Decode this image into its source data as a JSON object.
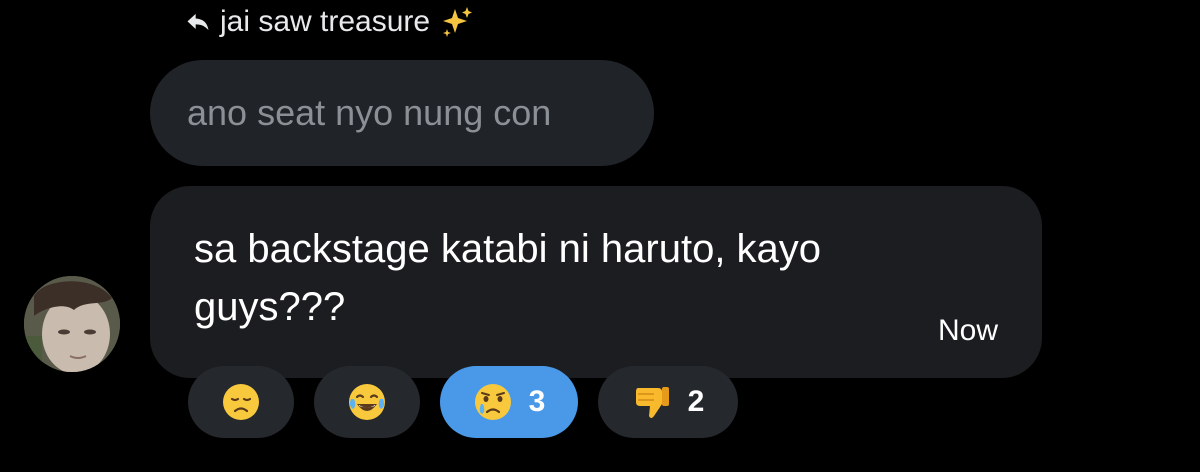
{
  "reply": {
    "author_label": "jai saw treasure",
    "arrow_icon": "reply-arrow-icon",
    "sparkle_icon": "sparkles-icon"
  },
  "quoted_message": {
    "text": "ano seat nyo nung con"
  },
  "message": {
    "text": "sa backstage katabi ni haruto, kayo guys???",
    "timestamp": "Now"
  },
  "reactions": [
    {
      "emoji": "disappointed-face-icon",
      "count": ""
    },
    {
      "emoji": "tears-of-joy-face-icon",
      "count": ""
    },
    {
      "emoji": "crying-face-icon",
      "count": "3",
      "selected": true
    },
    {
      "emoji": "thumbs-down-icon",
      "count": "2"
    }
  ],
  "colors": {
    "background": "#000000",
    "quoted_bubble": "#202327",
    "message_bubble": "#1c1d21",
    "reaction_pill": "#25282c",
    "reaction_selected": "#4a99e9"
  }
}
